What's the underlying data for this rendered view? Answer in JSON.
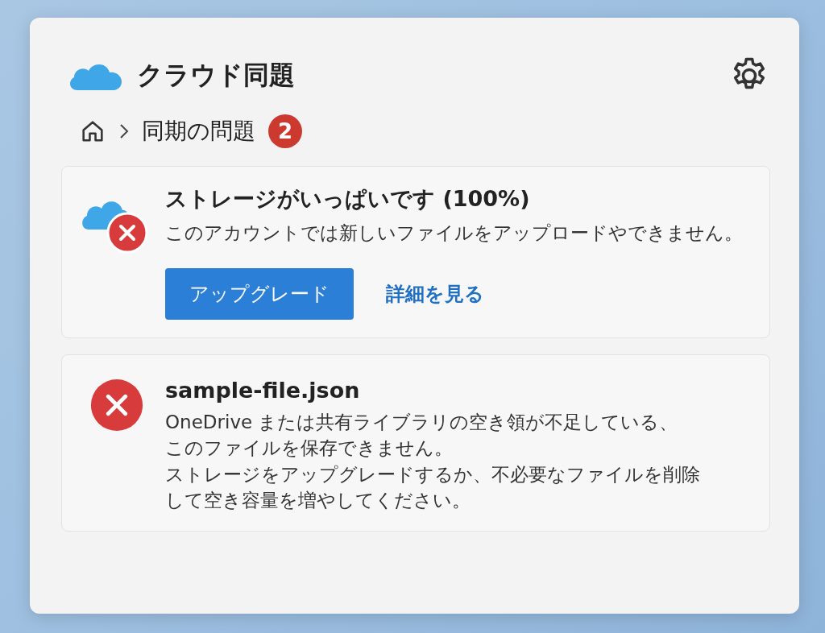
{
  "header": {
    "title": "クラウド同題"
  },
  "breadcrumb": {
    "current": "同期の問題",
    "badge": "2"
  },
  "issues": [
    {
      "kind": "storage",
      "title": "ストレージがいっぱいです (100%)",
      "lines": [
        "このアカウントでは新しいファイルをアップロードやできません。"
      ],
      "actions": [
        {
          "kind": "primary",
          "label": "アップグレード"
        },
        {
          "kind": "link",
          "label": "詳細を見る"
        }
      ]
    },
    {
      "kind": "file",
      "title": "sample-file.json",
      "lines": [
        "OneDrive または共有ライブラリの空き領が不足している、",
        "このファイルを保存できません。",
        "ストレージをアップグレードするか、不必要なファイルを削除",
        "して空き容量を増やしてください。"
      ]
    }
  ]
}
